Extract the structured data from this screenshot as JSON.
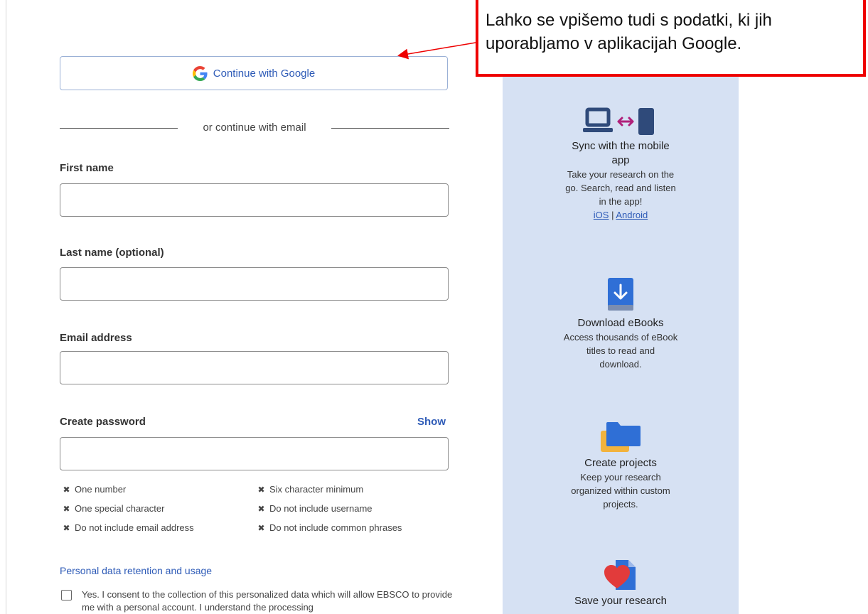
{
  "google_button": {
    "label": "Continue with Google"
  },
  "divider": {
    "text": "or continue with email"
  },
  "form": {
    "first_name": {
      "label": "First name",
      "value": ""
    },
    "last_name": {
      "label": "Last name (optional)",
      "value": ""
    },
    "email": {
      "label": "Email address",
      "value": ""
    },
    "password": {
      "label": "Create password",
      "value": "",
      "show_label": "Show"
    }
  },
  "password_requirements": [
    "One number",
    "Six character minimum",
    "One special character",
    "Do not include username",
    "Do not include email address",
    "Do not include common phrases"
  ],
  "privacy": {
    "link": "Personal data retention and usage",
    "consent_text": "Yes. I consent to the collection of this personalized data which will allow EBSCO to provide me with a personal account. I understand the processing"
  },
  "promo": {
    "sync": {
      "title_line1": "Sync with the mobile",
      "title_line2": "app",
      "desc_line1": "Take your research on the",
      "desc_line2": "go. Search, read and listen",
      "desc_line3": "in the app!",
      "link_ios": "iOS",
      "separator": "|",
      "link_android": "Android"
    },
    "ebooks": {
      "title": "Download eBooks",
      "desc_line1": "Access thousands of eBook",
      "desc_line2": "titles to read and",
      "desc_line3": "download."
    },
    "projects": {
      "title": "Create projects",
      "desc_line1": "Keep your research",
      "desc_line2": "organized within custom",
      "desc_line3": "projects."
    },
    "save": {
      "title": "Save your research"
    }
  },
  "callout": {
    "line1": "Lahko se vpišemo tudi s podatki, ki jih",
    "line2": "uporabljamo v aplikacijah Google."
  },
  "colors": {
    "accent_blue": "#2e5bb7",
    "promo_bg": "#d6e1f3",
    "callout_red": "#ee0000"
  }
}
